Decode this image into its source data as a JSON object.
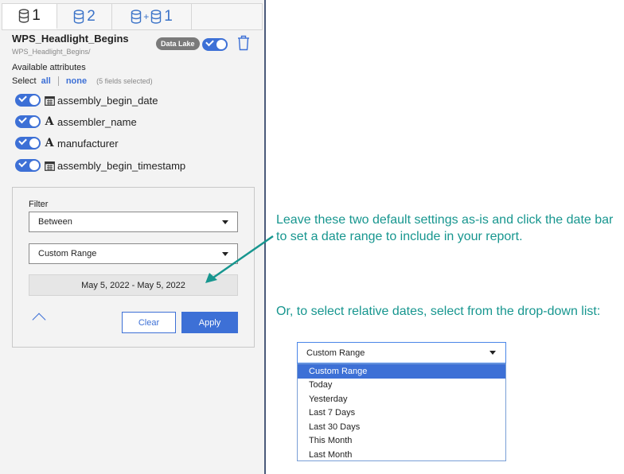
{
  "tabs": [
    {
      "label": "1",
      "icon": "database-icon",
      "active": true
    },
    {
      "label": "2",
      "icon": "database-icon",
      "active": false
    },
    {
      "label": "1",
      "icon": "database-plus-database-icon",
      "plus": "+",
      "active": false
    }
  ],
  "datasource": {
    "title": "WPS_Headlight_Begins",
    "path": "WPS_Headlight_Begins/",
    "badge": "Data Lake"
  },
  "attributes": {
    "heading": "Available attributes",
    "select_label": "Select",
    "all_label": "all",
    "none_label": "none",
    "count_label": "(5 fields selected)",
    "items": [
      {
        "name": "assembly_begin_date",
        "icon": "calendar-icon",
        "enabled": true
      },
      {
        "name": "assembler_name",
        "icon": "text-type-icon",
        "icon_glyph": "A",
        "enabled": true
      },
      {
        "name": "manufacturer",
        "icon": "text-type-icon",
        "icon_glyph": "A",
        "enabled": true
      },
      {
        "name": "assembly_begin_timestamp",
        "icon": "calendar-icon",
        "enabled": true
      }
    ]
  },
  "filter": {
    "label": "Filter",
    "operator": "Between",
    "range": "Custom Range",
    "date_range": "May 5, 2022 - May 5, 2022",
    "clear_label": "Clear",
    "apply_label": "Apply"
  },
  "annotations": {
    "note1": "Leave these two default settings as-is  and click the date bar to set a date range to include in your report.",
    "note2": "Or, to select relative dates, select from the drop-down list:",
    "color": "#17968f"
  },
  "dropdown": {
    "selected": "Custom Range",
    "options": [
      "Custom Range",
      "Today",
      "Yesterday",
      "Last 7 Days",
      "Last 30 Days",
      "This Month",
      "Last Month"
    ]
  },
  "colors": {
    "accent": "#3d70d6",
    "badge": "#7a7a7a"
  }
}
